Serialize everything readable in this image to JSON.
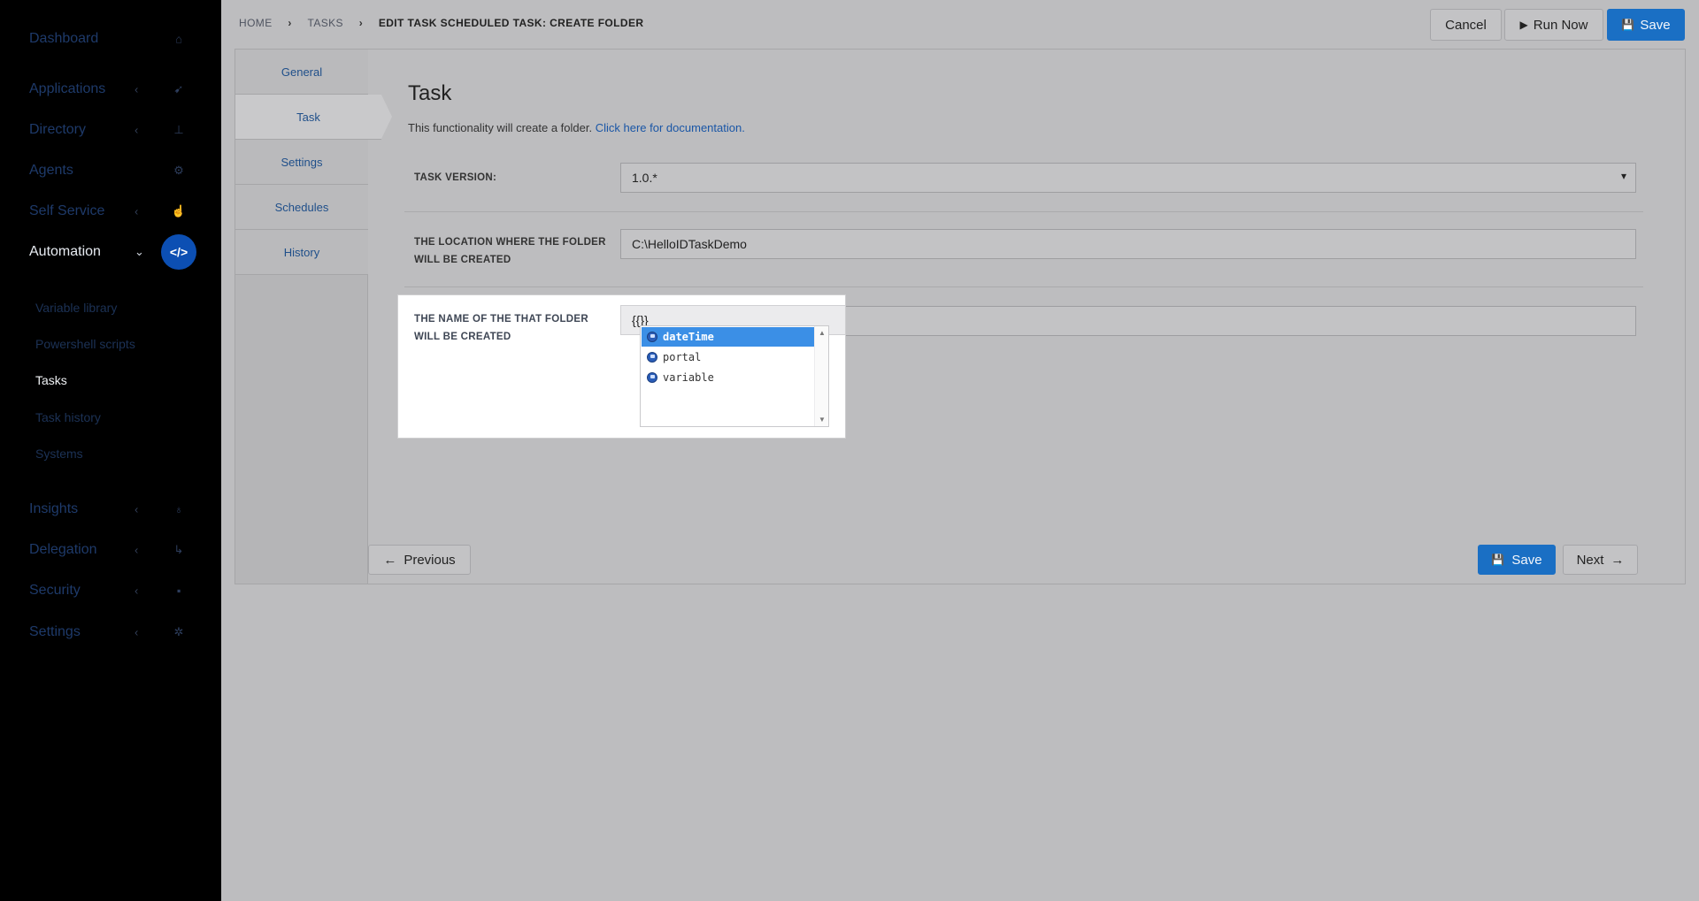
{
  "sidebar": {
    "items": [
      {
        "label": "Dashboard",
        "icon": "home-icon",
        "glyph": "⌂",
        "chevron": ""
      },
      {
        "label": "Applications",
        "icon": "rocket-icon",
        "glyph": "➹",
        "chevron": "‹"
      },
      {
        "label": "Directory",
        "icon": "sitemap-icon",
        "glyph": "⊥",
        "chevron": "‹"
      },
      {
        "label": "Agents",
        "icon": "agents-icon",
        "glyph": "⚙",
        "chevron": ""
      },
      {
        "label": "Self Service",
        "icon": "hand-pointer-icon",
        "glyph": "☝",
        "chevron": "‹"
      },
      {
        "label": "Automation",
        "icon": "code-icon",
        "glyph": "</>",
        "chevron": "⌄"
      },
      {
        "label": "Insights",
        "icon": "lightbulb-icon",
        "glyph": "♁",
        "chevron": "‹"
      },
      {
        "label": "Delegation",
        "icon": "delegation-icon",
        "glyph": "↳",
        "chevron": "‹"
      },
      {
        "label": "Security",
        "icon": "lock-icon",
        "glyph": "▪",
        "chevron": "‹"
      },
      {
        "label": "Settings",
        "icon": "gear-icon",
        "glyph": "✲",
        "chevron": "‹"
      }
    ],
    "subitems": [
      {
        "label": "Variable library"
      },
      {
        "label": "Powershell scripts"
      },
      {
        "label": "Tasks"
      },
      {
        "label": "Task history"
      },
      {
        "label": "Systems"
      }
    ]
  },
  "breadcrumb": {
    "home": "HOME",
    "tasks": "TASKS",
    "current": "EDIT TASK SCHEDULED TASK: CREATE FOLDER",
    "sep": "›"
  },
  "toolbar": {
    "cancel": "Cancel",
    "run_now": "Run Now",
    "save": "Save",
    "run_glyph": "▶",
    "save_glyph": "💾"
  },
  "tabs": [
    {
      "label": "General"
    },
    {
      "label": "Task"
    },
    {
      "label": "Settings"
    },
    {
      "label": "Schedules"
    },
    {
      "label": "History"
    }
  ],
  "task": {
    "title": "Task",
    "description": "This functionality will create a folder.",
    "doc_link": "Click here for documentation.",
    "fields": {
      "version_label": "TASK VERSION:",
      "version_value": "1.0.*",
      "location_label": "THE LOCATION WHERE THE FOLDER WILL BE CREATED",
      "location_value": "C:\\HelloIDTaskDemo",
      "name_label": "THE NAME OF THE THAT FOLDER WILL BE CREATED",
      "name_value": "{{}}"
    },
    "autocomplete": {
      "items": [
        {
          "label": "dateTime",
          "selected": true
        },
        {
          "label": "portal",
          "selected": false
        },
        {
          "label": "variable",
          "selected": false
        }
      ],
      "scroll_up": "▲",
      "scroll_down": "▼"
    }
  },
  "footer": {
    "previous": "Previous",
    "save": "Save",
    "next": "Next",
    "prev_glyph": "←",
    "next_glyph": "→"
  },
  "colors": {
    "primary": "#1a6fc4",
    "selection": "#3b8fe6",
    "sidebar_bg": "#000000"
  }
}
